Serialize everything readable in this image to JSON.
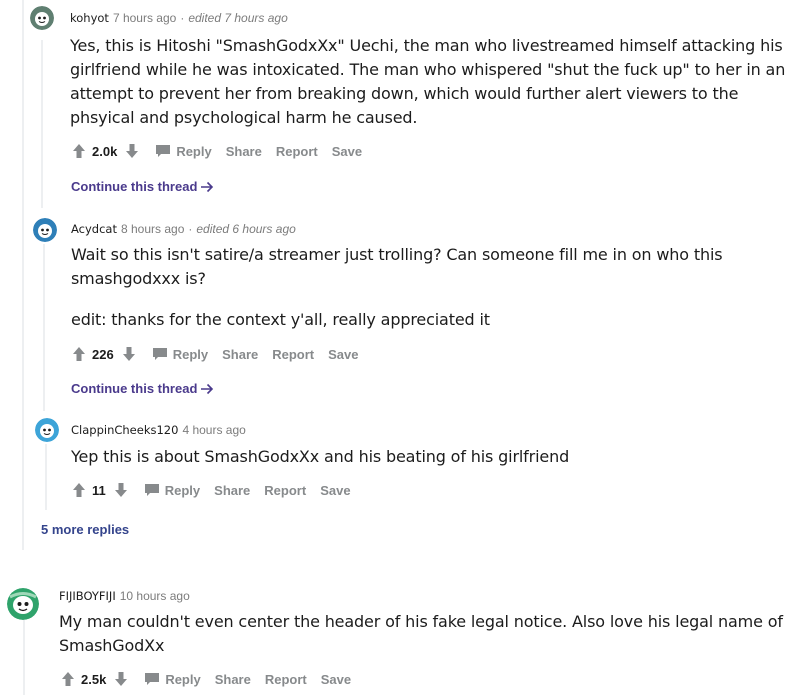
{
  "comments": [
    {
      "username": "kohyot",
      "time": "7 hours ago",
      "edited": "edited 7 hours ago",
      "body": [
        "Yes, this is Hitoshi \"SmashGodxXx\" Uechi, the man who livestreamed himself attacking his girlfriend while he was intoxicated. The man who whispered \"shut the fuck up\" to her in an attempt to prevent her from breaking down, which would further alert viewers to the phsyical and psychological harm he caused."
      ],
      "score": "2.0k",
      "continue": "Continue this thread",
      "avatar_color": "#5f7f71"
    },
    {
      "username": "Acydcat",
      "time": "8 hours ago",
      "edited": "edited 6 hours ago",
      "body": [
        "Wait so this isn't satire/a streamer just trolling? Can someone fill me in on who this smashgodxxx is?",
        "edit: thanks for the context y'all, really appreciated it"
      ],
      "score": "226",
      "continue": "Continue this thread",
      "avatar_color": "#2e7fb8"
    },
    {
      "username": "ClappinCheeks120",
      "time": "4 hours ago",
      "body": [
        "Yep this is about SmashGodxXx and his beating of his girlfriend"
      ],
      "score": "11",
      "avatar_color": "#3da4d8"
    },
    {
      "username": "FIJIBOYFIJI",
      "time": "10 hours ago",
      "body": [
        "My man couldn't even center the header of his fake legal notice. Also love his legal name of SmashGodXx"
      ],
      "score": "2.5k",
      "avatar_color": "#2fa36b"
    }
  ],
  "more_replies": "5 more replies",
  "actions": {
    "reply": "Reply",
    "share": "Share",
    "report": "Report",
    "save": "Save"
  },
  "icons": {
    "upvote": "upvote-arrow-icon",
    "downvote": "downvote-arrow-icon",
    "reply": "comment-bubble-icon",
    "continue": "arrow-right-icon"
  }
}
